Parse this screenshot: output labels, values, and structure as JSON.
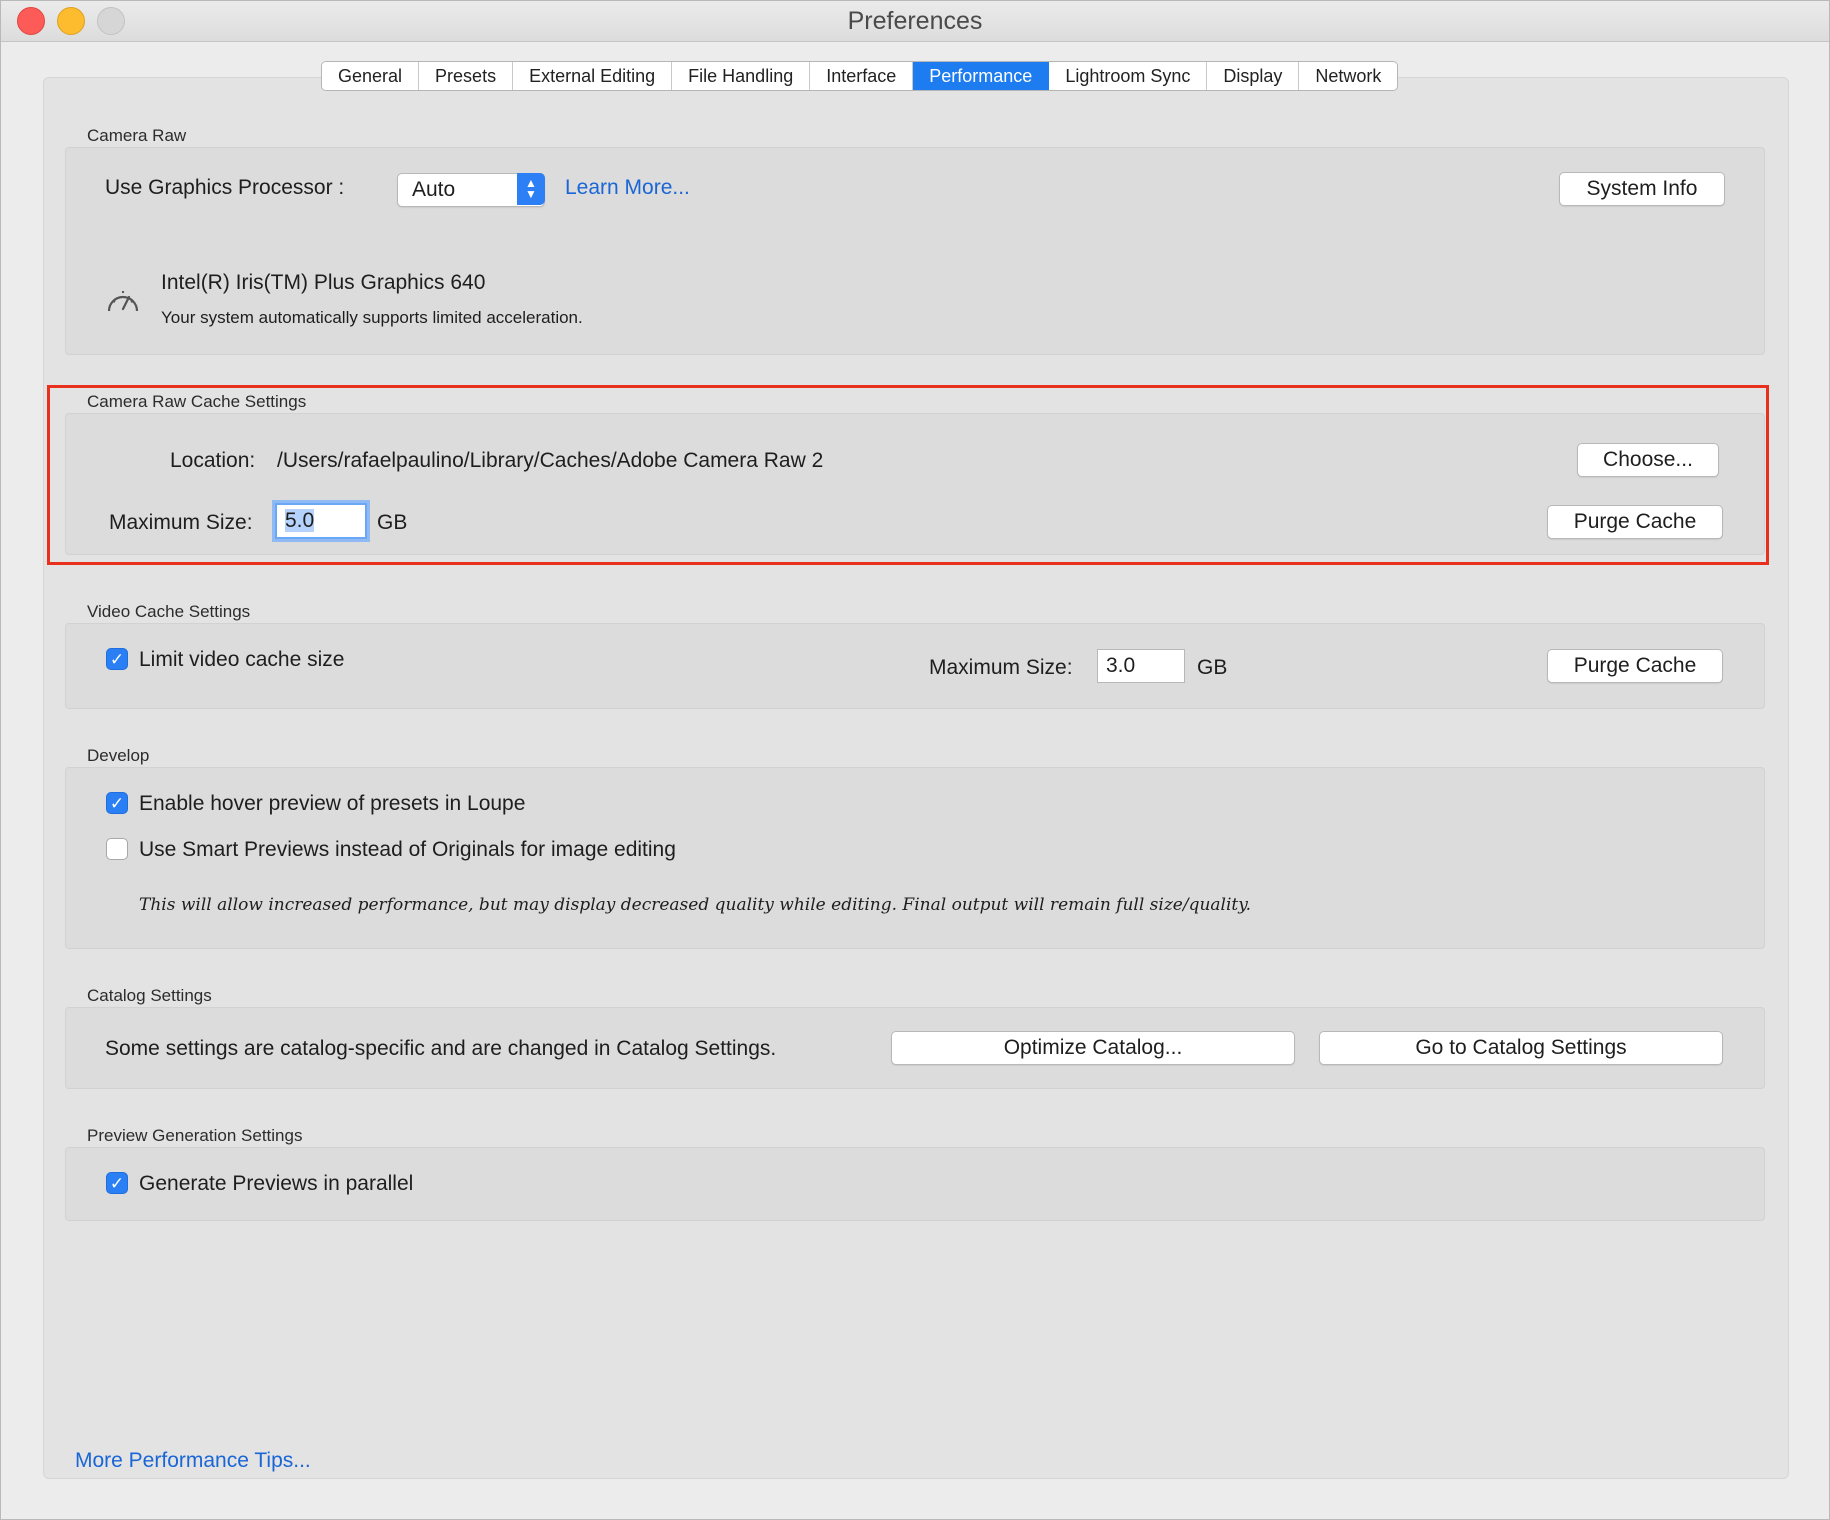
{
  "window": {
    "title": "Preferences"
  },
  "tabs": [
    {
      "label": "General"
    },
    {
      "label": "Presets"
    },
    {
      "label": "External Editing"
    },
    {
      "label": "File Handling"
    },
    {
      "label": "Interface"
    },
    {
      "label": "Performance",
      "active": true
    },
    {
      "label": "Lightroom Sync"
    },
    {
      "label": "Display"
    },
    {
      "label": "Network"
    }
  ],
  "camera_raw": {
    "section_title": "Camera Raw",
    "gpu_label": "Use Graphics Processor :",
    "gpu_value": "Auto",
    "learn_more": "Learn More...",
    "system_info": "System Info",
    "gpu_name": "Intel(R) Iris(TM) Plus Graphics 640",
    "gpu_note": "Your system automatically supports limited acceleration.",
    "gpu_icon": "gauge-icon"
  },
  "raw_cache": {
    "section_title": "Camera Raw Cache Settings",
    "location_label": "Location:",
    "location_value": "/Users/rafaelpaulino/Library/Caches/Adobe Camera Raw 2",
    "choose": "Choose...",
    "max_size_label": "Maximum Size:",
    "max_size_value": "5.0",
    "unit": "GB",
    "purge": "Purge Cache"
  },
  "video_cache": {
    "section_title": "Video Cache Settings",
    "limit_label": "Limit video cache size",
    "limit_checked": true,
    "max_size_label": "Maximum Size:",
    "max_size_value": "3.0",
    "unit": "GB",
    "purge": "Purge Cache"
  },
  "develop": {
    "section_title": "Develop",
    "hover_label": "Enable hover preview of presets in Loupe",
    "hover_checked": true,
    "smart_label": "Use Smart Previews instead of Originals for image editing",
    "smart_checked": false,
    "note": "This will allow increased performance, but may display decreased quality while editing. Final output will remain full size/quality."
  },
  "catalog": {
    "section_title": "Catalog Settings",
    "text": "Some settings are catalog-specific and are changed in Catalog Settings.",
    "optimize": "Optimize Catalog...",
    "go_to": "Go to Catalog Settings"
  },
  "preview": {
    "section_title": "Preview Generation Settings",
    "parallel_label": "Generate Previews in parallel",
    "parallel_checked": true
  },
  "footer": {
    "tips_link": "More Performance Tips..."
  },
  "colors": {
    "accent": "#1d7cf0",
    "link": "#1a66d6",
    "highlight": "#e8301d"
  }
}
